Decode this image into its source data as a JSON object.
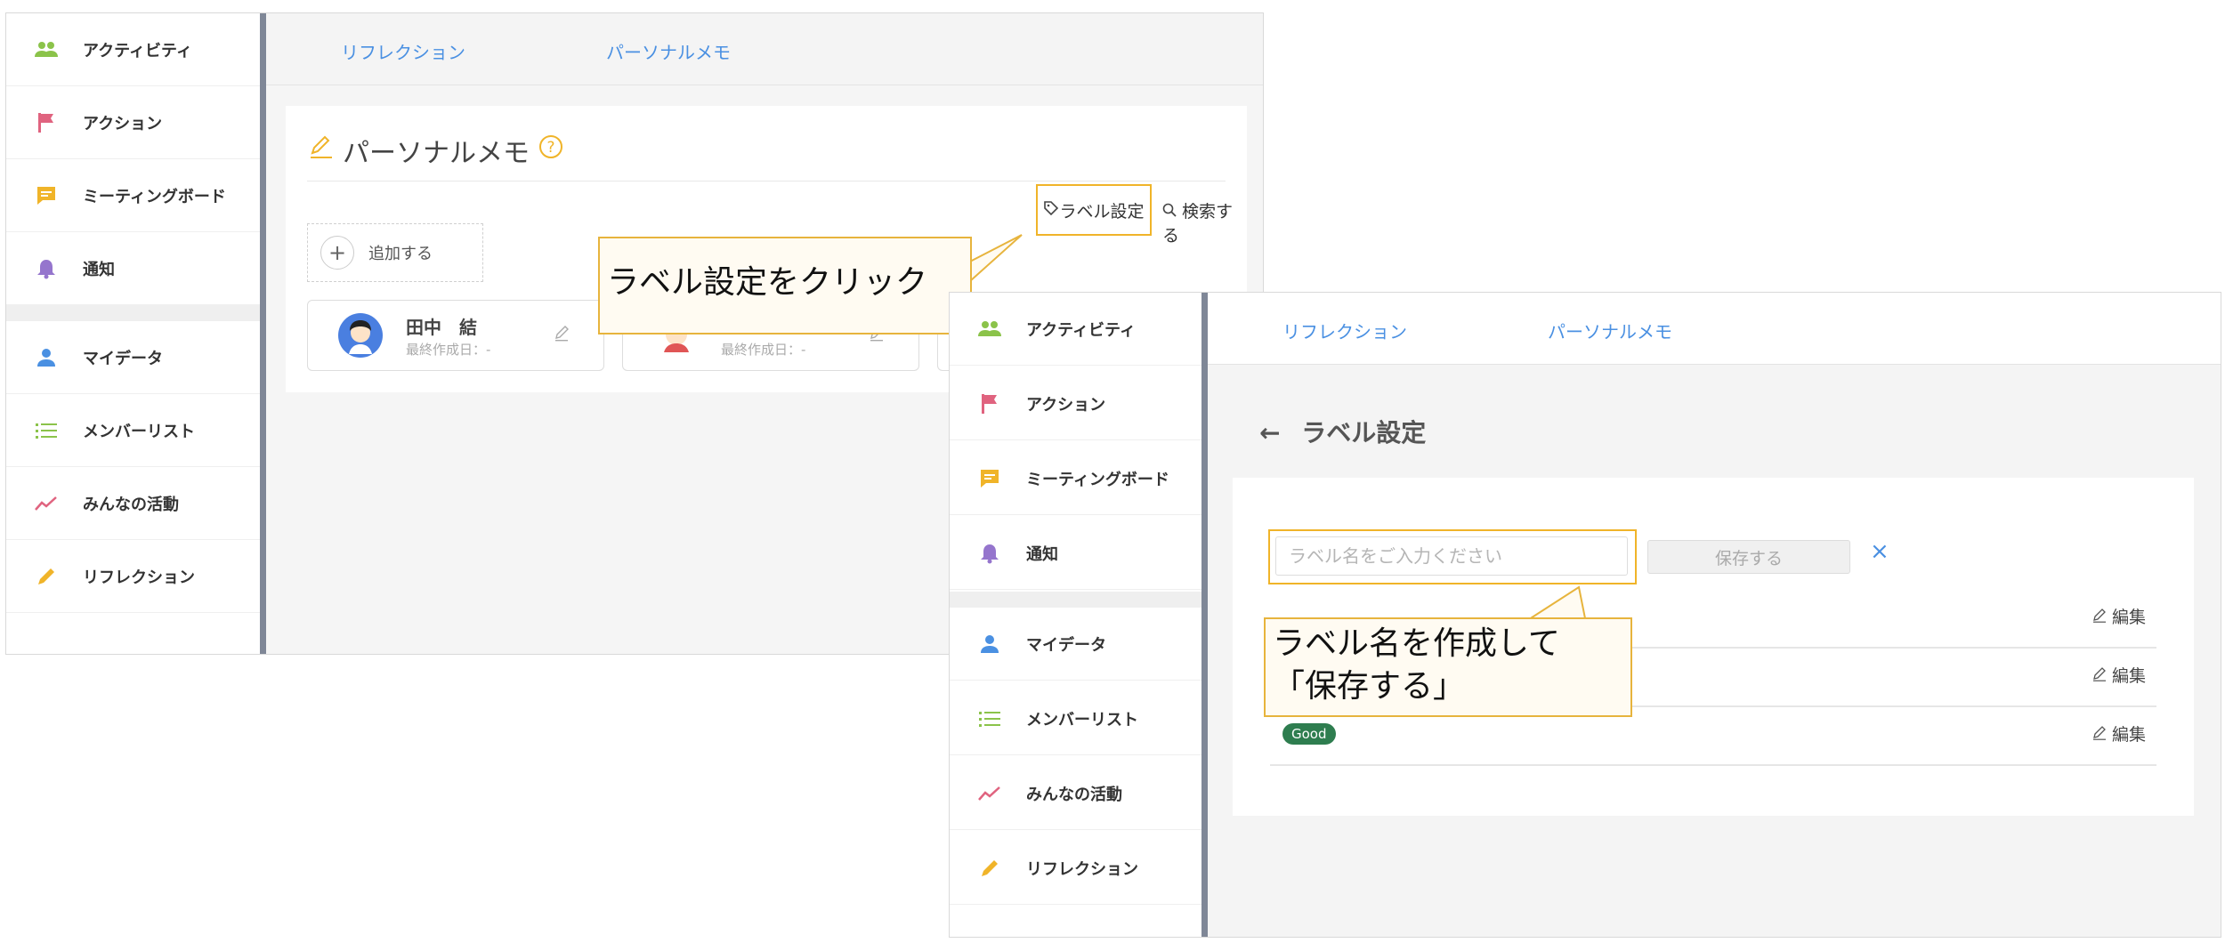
{
  "sidebar": {
    "items": [
      {
        "label": "アクティビティ",
        "icon": "people-icon",
        "color": "#8bc34a"
      },
      {
        "label": "アクション",
        "icon": "flag-icon",
        "color": "#e0637f"
      },
      {
        "label": "ミーティングボード",
        "icon": "chat-icon",
        "color": "#f0b429"
      },
      {
        "label": "通知",
        "icon": "bell-icon",
        "color": "#9575cd"
      },
      {
        "label": "マイデータ",
        "icon": "person-icon",
        "color": "#4a90e2"
      },
      {
        "label": "メンバーリスト",
        "icon": "list-icon",
        "color": "#8bc34a"
      },
      {
        "label": "みんなの活動",
        "icon": "trend-icon",
        "color": "#e0637f"
      },
      {
        "label": "リフレクション",
        "icon": "pencil-icon",
        "color": "#f0b429"
      }
    ]
  },
  "tabs": [
    "リフレクション",
    "パーソナルメモ"
  ],
  "screen1": {
    "title": "パーソナルメモ",
    "label_settings": "ラベル設定",
    "search": "検索する",
    "add": "追加する",
    "cards": [
      {
        "name": "田中　結",
        "date": "最終作成日：-"
      },
      {
        "name": "",
        "date": "最終作成日：-"
      }
    ]
  },
  "callouts": {
    "first": "ラベル設定をクリック",
    "second": "ラベル名を作成して「保存する」"
  },
  "screen2": {
    "title": "ラベル設定",
    "back": "←",
    "placeholder": "ラベル名をご入力ください",
    "save": "保存する",
    "close": "×",
    "edit": "編集",
    "rows": [
      "",
      "",
      "Good"
    ]
  },
  "colors": {
    "accent": "#f0b429",
    "link": "#4a90e2",
    "badge": "#2e7d4f"
  }
}
